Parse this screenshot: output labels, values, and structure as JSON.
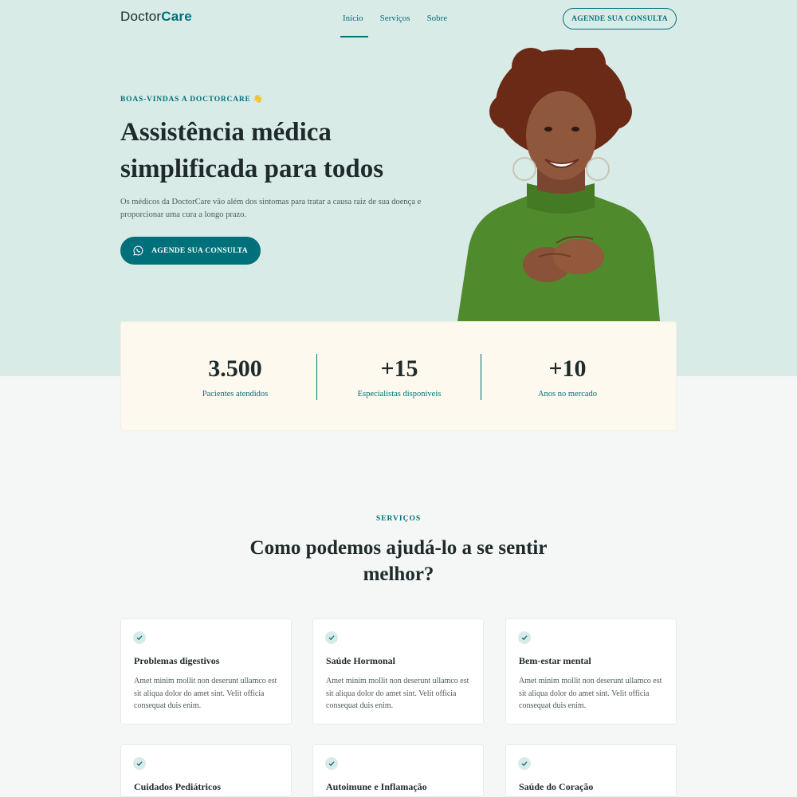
{
  "header": {
    "logo_doctor": "Doctor",
    "logo_care": "Care",
    "nav": [
      "Início",
      "Serviços",
      "Sobre"
    ],
    "cta": "AGENDE SUA CONSULTA"
  },
  "hero": {
    "eyebrow": "BOAS-VINDAS A DOCTORCARE 👋",
    "title": "Assistência médica simplificada para todos",
    "text": "Os médicos da DoctorCare vão além dos sintomas para tratar a causa raiz de sua doença e proporcionar uma cura a longo prazo.",
    "cta": "AGENDE SUA CONSULTA"
  },
  "stats": [
    {
      "value": "3.500",
      "label": "Pacientes atendidos"
    },
    {
      "value": "+15",
      "label": "Especialistas disponíveis"
    },
    {
      "value": "+10",
      "label": "Anos no mercado"
    }
  ],
  "services": {
    "eyebrow": "SERVIÇOS",
    "title": "Como podemos ajudá-lo a se sentir melhor?",
    "cards": [
      {
        "title": "Problemas digestivos",
        "text": "Amet minim mollit non deserunt ullamco est sit aliqua dolor do amet sint. Velit officia consequat duis enim."
      },
      {
        "title": "Saúde Hormonal",
        "text": "Amet minim mollit non deserunt ullamco est sit aliqua dolor do amet sint. Velit officia consequat duis enim."
      },
      {
        "title": "Bem-estar mental",
        "text": "Amet minim mollit non deserunt ullamco est sit aliqua dolor do amet sint. Velit officia consequat duis enim."
      },
      {
        "title": "Cuidados Pediátricos",
        "text": ""
      },
      {
        "title": "Autoimune e Inflamação",
        "text": ""
      },
      {
        "title": "Saúde do Coração",
        "text": ""
      }
    ]
  },
  "colors": {
    "brand": "#00707a",
    "hero_bg": "#d9ebe7",
    "stats_bg": "#fdf9ee",
    "page_bg": "#f4f7f6"
  },
  "icons": {
    "cta": "whatsapp-icon",
    "card": "check-icon"
  }
}
